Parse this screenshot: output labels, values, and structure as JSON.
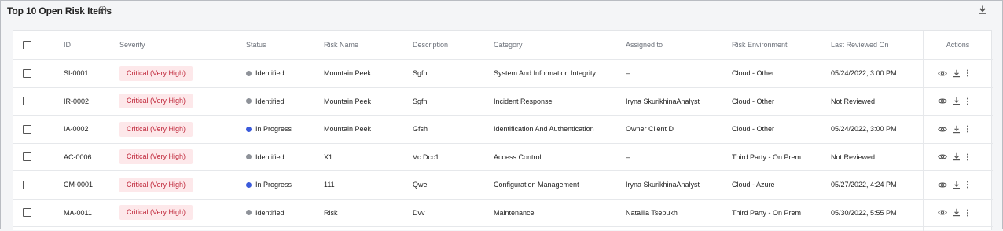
{
  "widget": {
    "title": "Top 10 Open Risk Items",
    "info_icon": "info-icon",
    "download_icon": "download-icon"
  },
  "table": {
    "headers": {
      "id": "ID",
      "severity": "Severity",
      "status": "Status",
      "risk_name": "Risk Name",
      "description": "Description",
      "category": "Category",
      "assigned_to": "Assigned to",
      "risk_environment": "Risk Environment",
      "last_reviewed_on": "Last Reviewed On",
      "actions": "Actions"
    },
    "status_colors": {
      "Identified": "#8e9299",
      "In Progress": "#3b5bdb"
    },
    "severity_colors": {
      "background": "#fde8ea",
      "text": "#c0283b"
    },
    "action_icons": [
      "eye-icon",
      "download-icon",
      "more-vertical-icon"
    ],
    "rows": [
      {
        "id": "SI-0001",
        "severity": "Critical (Very High)",
        "status": "Identified",
        "risk_name": "Mountain Peek",
        "description": "Sgfn",
        "category": "System And Information Integrity",
        "assigned_to": "–",
        "risk_environment": "Cloud - Other",
        "last_reviewed_on": "05/24/2022, 3:00 PM"
      },
      {
        "id": "IR-0002",
        "severity": "Critical (Very High)",
        "status": "Identified",
        "risk_name": "Mountain Peek",
        "description": "Sgfn",
        "category": "Incident Response",
        "assigned_to": "Iryna SkurikhinaAnalyst",
        "risk_environment": "Cloud - Other",
        "last_reviewed_on": "Not Reviewed"
      },
      {
        "id": "IA-0002",
        "severity": "Critical (Very High)",
        "status": "In Progress",
        "risk_name": "Mountain Peek",
        "description": "Gfsh",
        "category": "Identification And Authentication",
        "assigned_to": "Owner Client D",
        "risk_environment": "Cloud - Other",
        "last_reviewed_on": "05/24/2022, 3:00 PM"
      },
      {
        "id": "AC-0006",
        "severity": "Critical (Very High)",
        "status": "Identified",
        "risk_name": "X1",
        "description": "Vc Dcc1",
        "category": "Access Control",
        "assigned_to": "–",
        "risk_environment": "Third Party - On Prem",
        "last_reviewed_on": "Not Reviewed"
      },
      {
        "id": "CM-0001",
        "severity": "Critical (Very High)",
        "status": "In Progress",
        "risk_name": "111",
        "description": "Qwe",
        "category": "Configuration Management",
        "assigned_to": "Iryna SkurikhinaAnalyst",
        "risk_environment": "Cloud - Azure",
        "last_reviewed_on": "05/27/2022, 4:24 PM"
      },
      {
        "id": "MA-0011",
        "severity": "Critical (Very High)",
        "status": "Identified",
        "risk_name": "Risk",
        "description": "Dvv",
        "category": "Maintenance",
        "assigned_to": "Nataliia Tsepukh",
        "risk_environment": "Third Party - On Prem",
        "last_reviewed_on": "05/30/2022, 5:55 PM"
      }
    ]
  }
}
